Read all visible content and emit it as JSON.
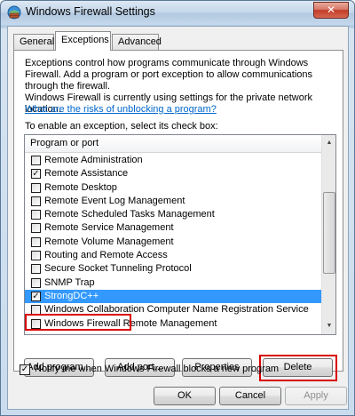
{
  "window": {
    "title": "Windows Firewall Settings",
    "close_glyph": "✕"
  },
  "tabs": [
    {
      "label": "General",
      "active": false
    },
    {
      "label": "Exceptions",
      "active": true
    },
    {
      "label": "Advanced",
      "active": false
    }
  ],
  "exceptions": {
    "intro": "Exceptions control how programs communicate through Windows Firewall. Add a program or port exception to allow communications through the firewall.",
    "status": "Windows Firewall is currently using settings for the private network location.",
    "risk_link": "What are the risks of unblocking a program?",
    "instruction": "To enable an exception, select its check box:",
    "list_header": "Program or port",
    "items": [
      {
        "label": "Remote Administration",
        "checked": false,
        "selected": false
      },
      {
        "label": "Remote Assistance",
        "checked": true,
        "selected": false
      },
      {
        "label": "Remote Desktop",
        "checked": false,
        "selected": false
      },
      {
        "label": "Remote Event Log Management",
        "checked": false,
        "selected": false
      },
      {
        "label": "Remote Scheduled Tasks Management",
        "checked": false,
        "selected": false
      },
      {
        "label": "Remote Service Management",
        "checked": false,
        "selected": false
      },
      {
        "label": "Remote Volume Management",
        "checked": false,
        "selected": false
      },
      {
        "label": "Routing and Remote Access",
        "checked": false,
        "selected": false
      },
      {
        "label": "Secure Socket Tunneling Protocol",
        "checked": false,
        "selected": false
      },
      {
        "label": "SNMP Trap",
        "checked": false,
        "selected": false
      },
      {
        "label": "StrongDC++",
        "checked": true,
        "selected": true
      },
      {
        "label": "Windows Collaboration Computer Name Registration Service",
        "checked": false,
        "selected": false
      },
      {
        "label": "Windows Firewall Remote Management",
        "checked": false,
        "selected": false
      }
    ],
    "buttons": {
      "add_program": "Add program...",
      "add_port": "Add port...",
      "properties": "Properties",
      "delete": "Delete"
    },
    "notify_label": "Notify me when Windows Firewall blocks a new program",
    "notify_checked": true
  },
  "footer": {
    "ok": "OK",
    "cancel": "Cancel",
    "apply": "Apply"
  },
  "colors": {
    "selection": "#3399ff",
    "annotation": "#d90000",
    "link": "#0066cc"
  },
  "icons": {
    "title": "firewall-globe-icon",
    "scroll_up": "scroll-up-arrow-icon",
    "scroll_down": "scroll-down-arrow-icon"
  }
}
